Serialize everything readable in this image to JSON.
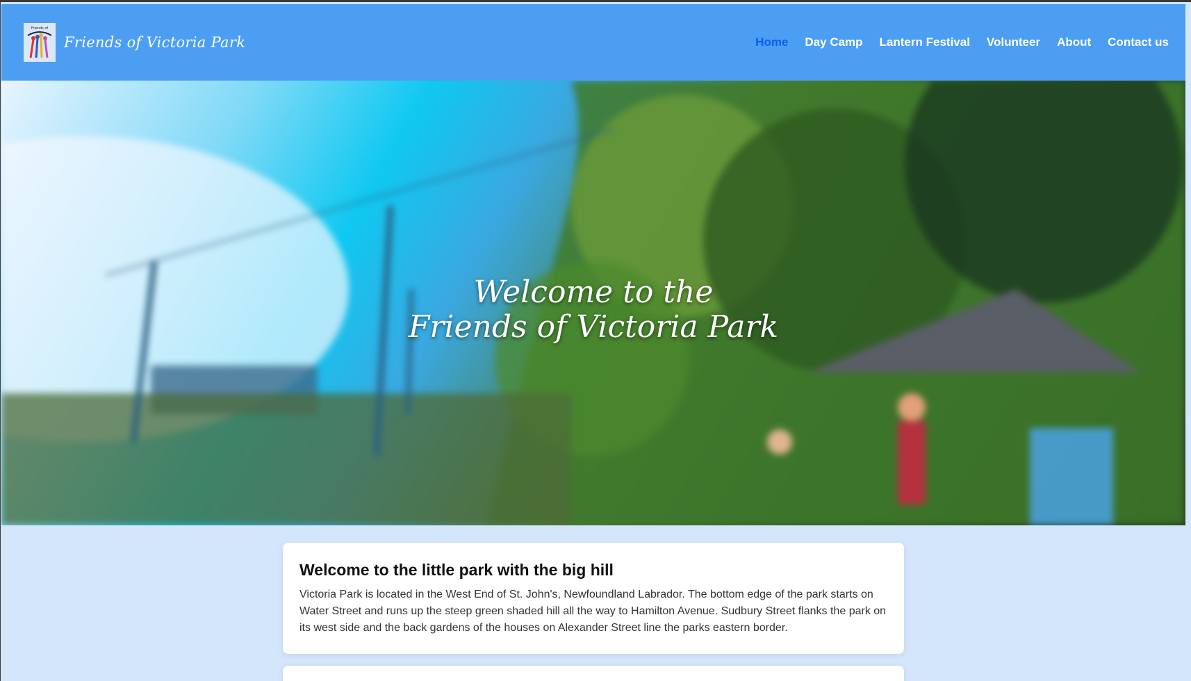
{
  "brand": {
    "name": "Friends of Victoria Park"
  },
  "nav": {
    "items": [
      "Home",
      "Day Camp",
      "Lantern Festival",
      "Volunteer",
      "About",
      "Contact us"
    ]
  },
  "hero": {
    "title_line1": "Welcome to the",
    "title_line2": "Friends of Victoria Park"
  },
  "intro": {
    "heading": "Welcome to the little park with the big hill",
    "body": "Victoria Park is located in the West End of St. John's, Newfoundland Labrador. The bottom edge of the park starts on Water Street and runs up the steep green shaded hill all the way to Hamilton Avenue. Sudbury Street flanks the park on its west side and the back gardens of the houses on Alexander Street line the parks eastern border."
  },
  "colors": {
    "navbar": "#4c9ef3",
    "active_link": "#0a5ee8",
    "page_bg": "#d4e6fb"
  },
  "logo": {
    "text": "Friends of Victoria Park"
  }
}
